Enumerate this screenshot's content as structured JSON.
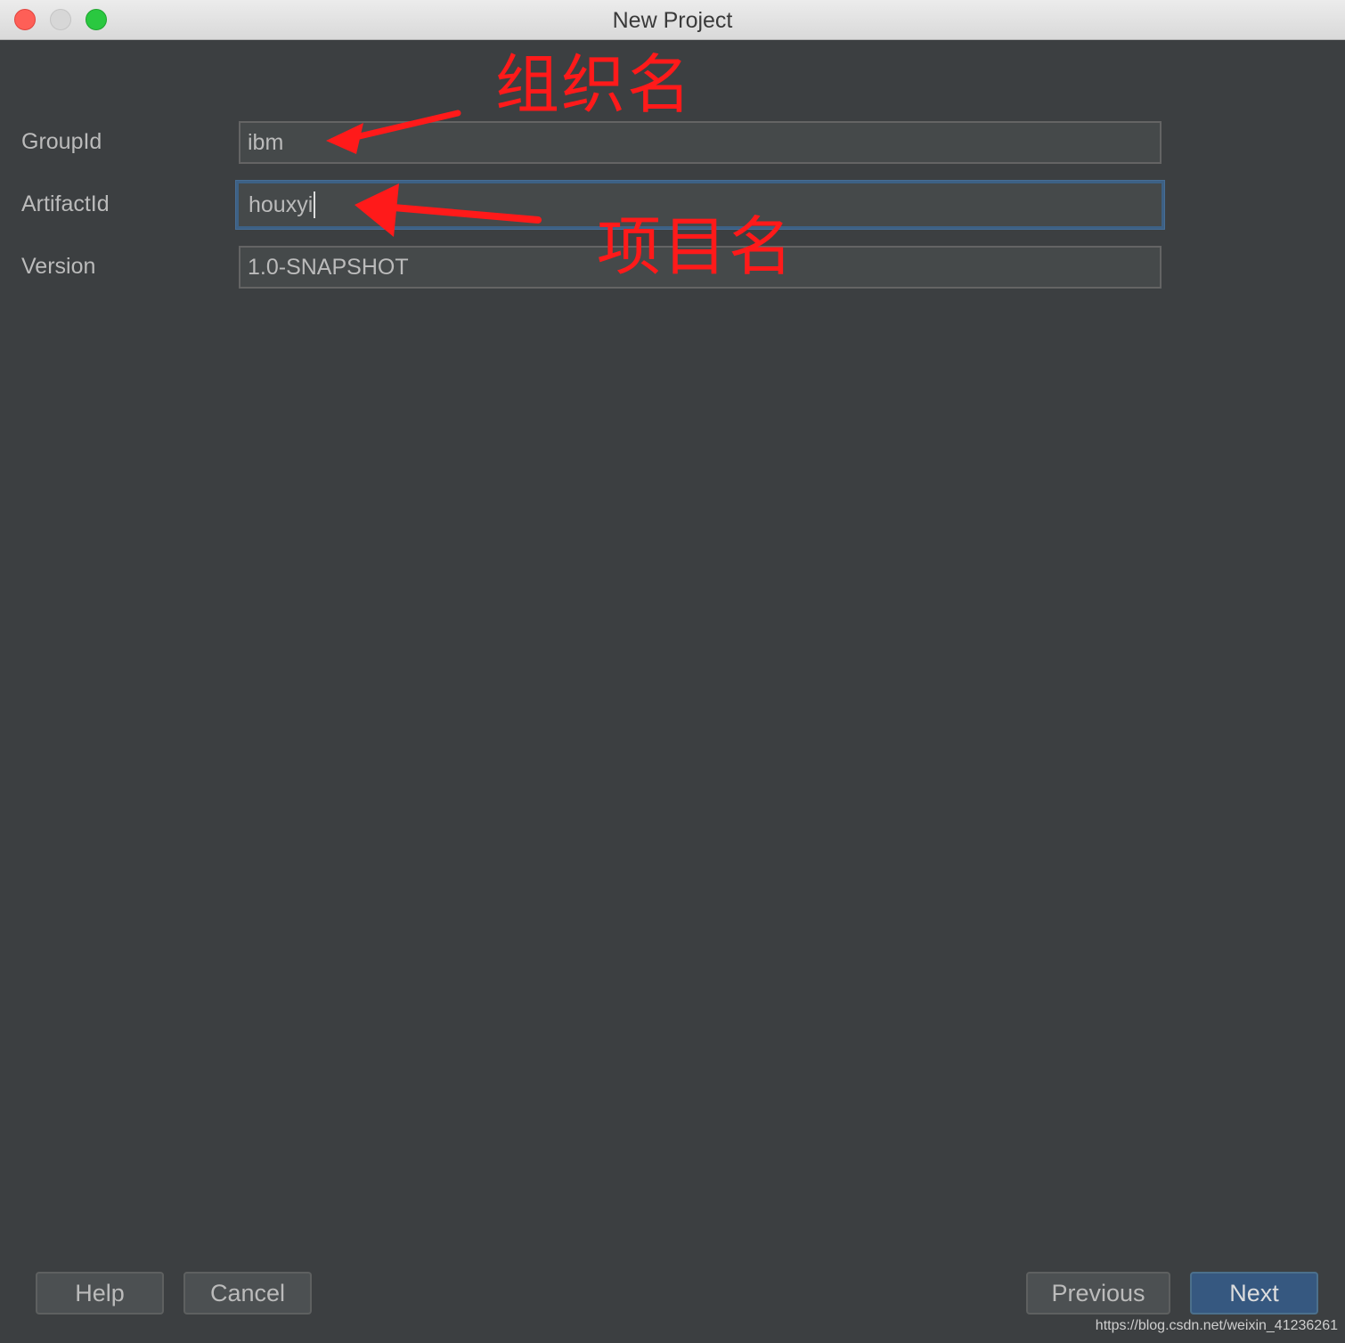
{
  "window": {
    "title": "New Project"
  },
  "form": {
    "group_label": "GroupId",
    "group_value": "ibm",
    "artifact_label": "ArtifactId",
    "artifact_value": "houxyi",
    "version_label": "Version",
    "version_value": "1.0-SNAPSHOT"
  },
  "annotations": {
    "group_note": "组织名",
    "artifact_note": "项目名",
    "color": "#ff1a1a"
  },
  "buttons": {
    "help": "Help",
    "cancel": "Cancel",
    "previous": "Previous",
    "next": "Next"
  },
  "watermark": "https://blog.csdn.net/weixin_41236261",
  "colors": {
    "background": "#3c3f41",
    "field_bg": "#45494a",
    "focus_border": "#3d6185",
    "primary_button": "#365880"
  }
}
